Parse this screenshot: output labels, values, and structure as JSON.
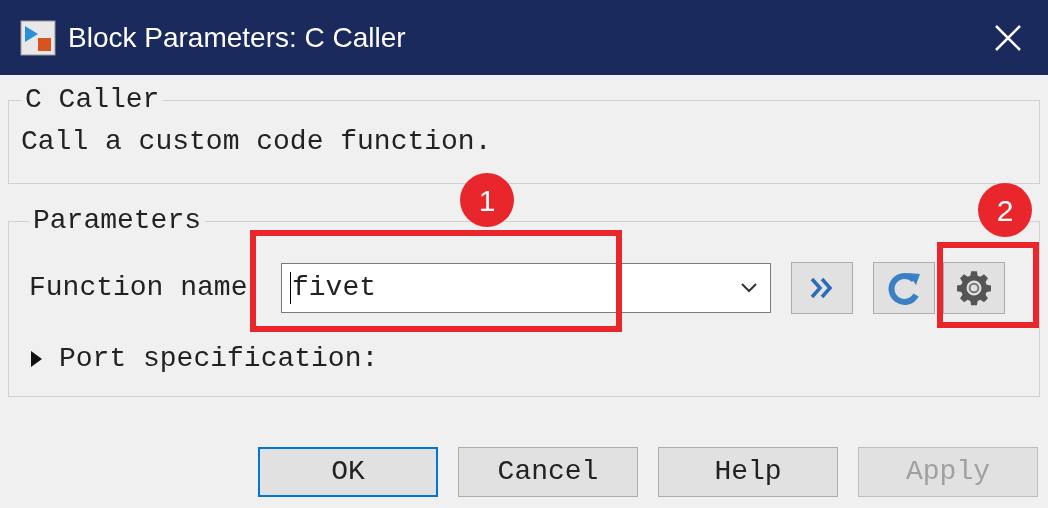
{
  "window": {
    "title": "Block Parameters: C Caller"
  },
  "description_group": {
    "title": "C Caller",
    "text": "Call a custom code function."
  },
  "parameters_group": {
    "title": "Parameters",
    "function_name": {
      "label": "Function name",
      "value": "fivet"
    },
    "port_specification": {
      "label": "Port specification:",
      "expanded": false
    }
  },
  "buttons": [
    {
      "label": "OK",
      "default": true,
      "disabled": false
    },
    {
      "label": "Cancel",
      "default": false,
      "disabled": false
    },
    {
      "label": "Help",
      "default": false,
      "disabled": false
    },
    {
      "label": "Apply",
      "default": false,
      "disabled": true
    }
  ],
  "annotations": [
    {
      "label": "1",
      "kind": "field"
    },
    {
      "label": "2",
      "kind": "settings"
    }
  ]
}
